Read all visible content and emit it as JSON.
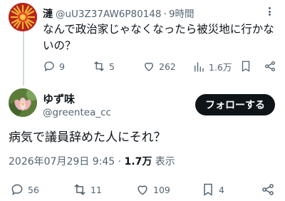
{
  "reply": {
    "name": "漣",
    "handle": "@uU3Z37AW6P80148",
    "dot": "·",
    "time": "9時間",
    "text": "なんで政治家じゃなくなったら被災地に行かないの？",
    "stats": {
      "replies": "9",
      "retweets": "5",
      "likes": "262",
      "views": "1.6万"
    }
  },
  "main": {
    "name": "ゆず味",
    "handle": "@greentea_cc",
    "follow_label": "フォローする",
    "text": "病気で議員辞めた人にそれ？",
    "timestamp": "2026年07月29日 9:45",
    "dot": "·",
    "views_count": "1.7万",
    "views_label": "表示",
    "stats": {
      "replies": "56",
      "retweets": "11",
      "likes": "109",
      "bookmarks": "4"
    }
  },
  "icons": [
    "more-icon",
    "reply-icon",
    "retweet-icon",
    "like-icon",
    "views-icon",
    "bookmark-icon",
    "share-icon"
  ],
  "colors": {
    "text": "#0f1419",
    "secondary": "#536471",
    "follow_bg": "#0f1419",
    "thread_line": "#cfd9de"
  }
}
